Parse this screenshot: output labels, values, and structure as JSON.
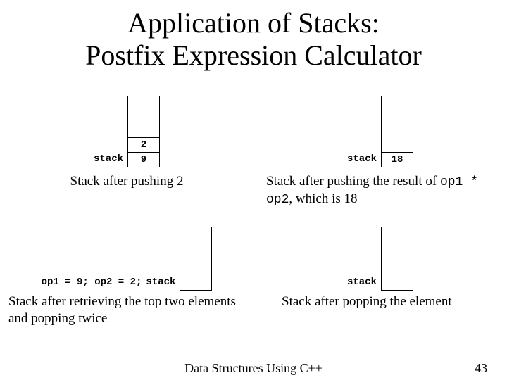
{
  "title_line1": "Application of Stacks:",
  "title_line2": "Postfix Expression Calculator",
  "stack_word": "stack",
  "figures": {
    "fig1_values": [
      "2",
      "9"
    ],
    "fig1_caption": "Stack after pushing 2",
    "fig2_values": [
      "18"
    ],
    "fig2_caption_a": "Stack after pushing the result of ",
    "fig2_caption_code1": "op1 *",
    "fig2_caption_code2": "op2",
    "fig2_caption_b": ", which is 18",
    "fig3_vars": "op1 = 9; op2 = 2;",
    "fig3_caption_a": "Stack after retrieving the top two elements",
    "fig3_caption_b": "and popping twice",
    "fig4_caption": "Stack after popping the element"
  },
  "footer_text": "Data Structures Using C++",
  "page_number": "43"
}
